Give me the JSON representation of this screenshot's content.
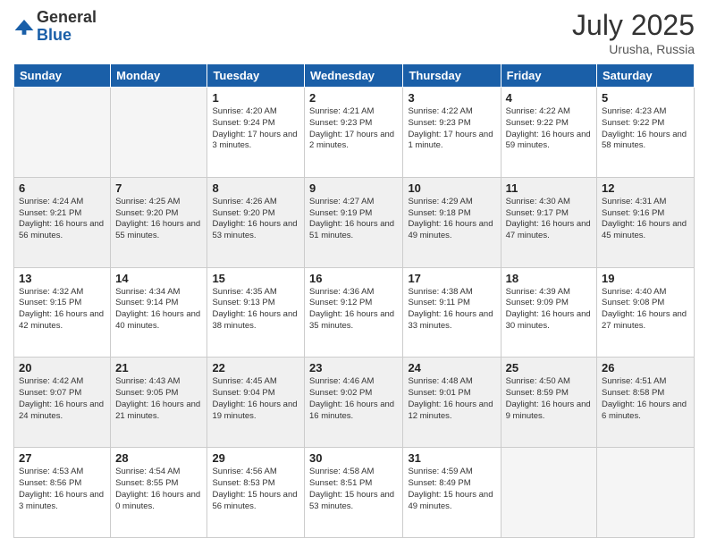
{
  "header": {
    "logo_general": "General",
    "logo_blue": "Blue",
    "main_title": "July 2025",
    "subtitle": "Urusha, Russia"
  },
  "weekdays": [
    "Sunday",
    "Monday",
    "Tuesday",
    "Wednesday",
    "Thursday",
    "Friday",
    "Saturday"
  ],
  "weeks": [
    [
      {
        "day": "",
        "empty": true
      },
      {
        "day": "",
        "empty": true
      },
      {
        "day": "1",
        "sunrise": "4:20 AM",
        "sunset": "9:24 PM",
        "daylight": "17 hours and 3 minutes."
      },
      {
        "day": "2",
        "sunrise": "4:21 AM",
        "sunset": "9:23 PM",
        "daylight": "17 hours and 2 minutes."
      },
      {
        "day": "3",
        "sunrise": "4:22 AM",
        "sunset": "9:23 PM",
        "daylight": "17 hours and 1 minute."
      },
      {
        "day": "4",
        "sunrise": "4:22 AM",
        "sunset": "9:22 PM",
        "daylight": "16 hours and 59 minutes."
      },
      {
        "day": "5",
        "sunrise": "4:23 AM",
        "sunset": "9:22 PM",
        "daylight": "16 hours and 58 minutes."
      }
    ],
    [
      {
        "day": "6",
        "sunrise": "4:24 AM",
        "sunset": "9:21 PM",
        "daylight": "16 hours and 56 minutes."
      },
      {
        "day": "7",
        "sunrise": "4:25 AM",
        "sunset": "9:20 PM",
        "daylight": "16 hours and 55 minutes."
      },
      {
        "day": "8",
        "sunrise": "4:26 AM",
        "sunset": "9:20 PM",
        "daylight": "16 hours and 53 minutes."
      },
      {
        "day": "9",
        "sunrise": "4:27 AM",
        "sunset": "9:19 PM",
        "daylight": "16 hours and 51 minutes."
      },
      {
        "day": "10",
        "sunrise": "4:29 AM",
        "sunset": "9:18 PM",
        "daylight": "16 hours and 49 minutes."
      },
      {
        "day": "11",
        "sunrise": "4:30 AM",
        "sunset": "9:17 PM",
        "daylight": "16 hours and 47 minutes."
      },
      {
        "day": "12",
        "sunrise": "4:31 AM",
        "sunset": "9:16 PM",
        "daylight": "16 hours and 45 minutes."
      }
    ],
    [
      {
        "day": "13",
        "sunrise": "4:32 AM",
        "sunset": "9:15 PM",
        "daylight": "16 hours and 42 minutes."
      },
      {
        "day": "14",
        "sunrise": "4:34 AM",
        "sunset": "9:14 PM",
        "daylight": "16 hours and 40 minutes."
      },
      {
        "day": "15",
        "sunrise": "4:35 AM",
        "sunset": "9:13 PM",
        "daylight": "16 hours and 38 minutes."
      },
      {
        "day": "16",
        "sunrise": "4:36 AM",
        "sunset": "9:12 PM",
        "daylight": "16 hours and 35 minutes."
      },
      {
        "day": "17",
        "sunrise": "4:38 AM",
        "sunset": "9:11 PM",
        "daylight": "16 hours and 33 minutes."
      },
      {
        "day": "18",
        "sunrise": "4:39 AM",
        "sunset": "9:09 PM",
        "daylight": "16 hours and 30 minutes."
      },
      {
        "day": "19",
        "sunrise": "4:40 AM",
        "sunset": "9:08 PM",
        "daylight": "16 hours and 27 minutes."
      }
    ],
    [
      {
        "day": "20",
        "sunrise": "4:42 AM",
        "sunset": "9:07 PM",
        "daylight": "16 hours and 24 minutes."
      },
      {
        "day": "21",
        "sunrise": "4:43 AM",
        "sunset": "9:05 PM",
        "daylight": "16 hours and 21 minutes."
      },
      {
        "day": "22",
        "sunrise": "4:45 AM",
        "sunset": "9:04 PM",
        "daylight": "16 hours and 19 minutes."
      },
      {
        "day": "23",
        "sunrise": "4:46 AM",
        "sunset": "9:02 PM",
        "daylight": "16 hours and 16 minutes."
      },
      {
        "day": "24",
        "sunrise": "4:48 AM",
        "sunset": "9:01 PM",
        "daylight": "16 hours and 12 minutes."
      },
      {
        "day": "25",
        "sunrise": "4:50 AM",
        "sunset": "8:59 PM",
        "daylight": "16 hours and 9 minutes."
      },
      {
        "day": "26",
        "sunrise": "4:51 AM",
        "sunset": "8:58 PM",
        "daylight": "16 hours and 6 minutes."
      }
    ],
    [
      {
        "day": "27",
        "sunrise": "4:53 AM",
        "sunset": "8:56 PM",
        "daylight": "16 hours and 3 minutes."
      },
      {
        "day": "28",
        "sunrise": "4:54 AM",
        "sunset": "8:55 PM",
        "daylight": "16 hours and 0 minutes."
      },
      {
        "day": "29",
        "sunrise": "4:56 AM",
        "sunset": "8:53 PM",
        "daylight": "15 hours and 56 minutes."
      },
      {
        "day": "30",
        "sunrise": "4:58 AM",
        "sunset": "8:51 PM",
        "daylight": "15 hours and 53 minutes."
      },
      {
        "day": "31",
        "sunrise": "4:59 AM",
        "sunset": "8:49 PM",
        "daylight": "15 hours and 49 minutes."
      },
      {
        "day": "",
        "empty": true
      },
      {
        "day": "",
        "empty": true
      }
    ]
  ]
}
